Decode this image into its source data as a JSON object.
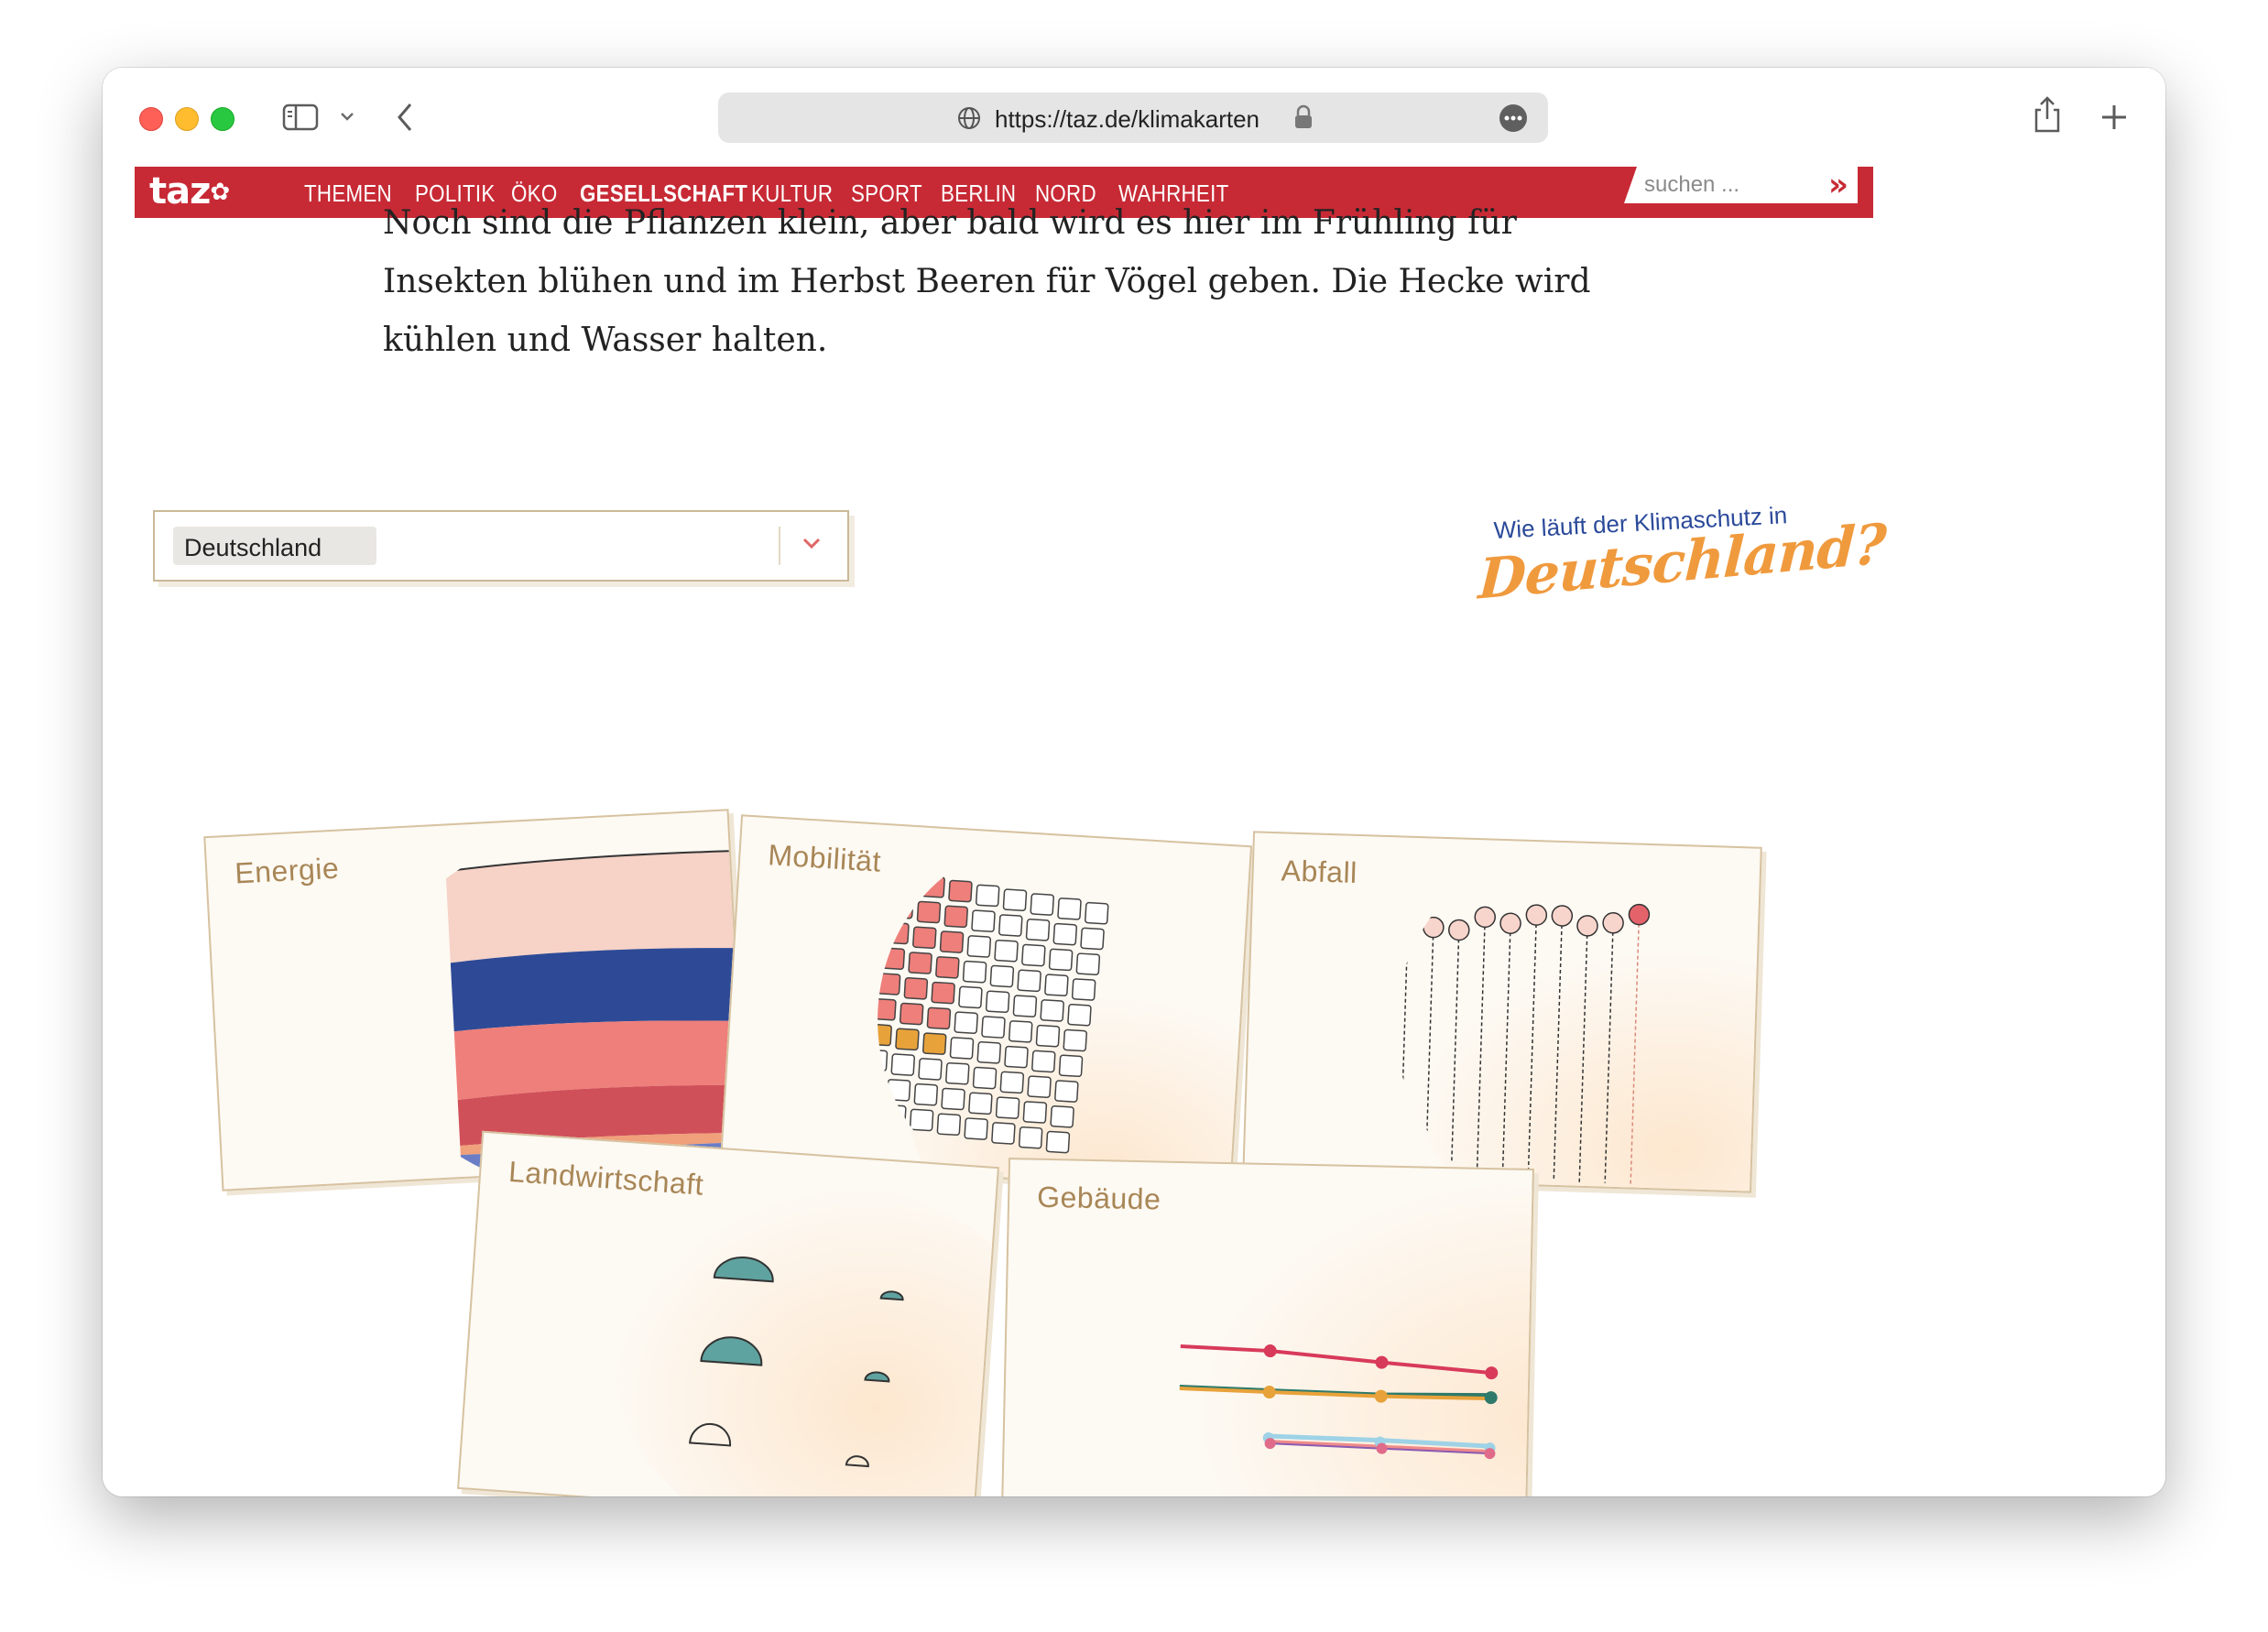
{
  "browser": {
    "url": "https://taz.de/klimakarten",
    "sidebar_icon": "sidebar-icon",
    "back_icon": "chevron-left-icon",
    "share_icon": "share-icon",
    "new_tab_icon": "plus-icon"
  },
  "site": {
    "logo": "taz",
    "nav": [
      "THEMEN",
      "POLITIK",
      "ÖKO",
      "GESELLSCHAFT",
      "KULTUR",
      "SPORT",
      "BERLIN",
      "NORD",
      "WAHRHEIT"
    ],
    "active_nav": "GESELLSCHAFT",
    "search_placeholder": "suchen ...",
    "search_button": "»",
    "brand_color": "#c72a35"
  },
  "article": {
    "lines": [
      "Noch sind die Pflanzen klein, aber bald wird es hier im Frühling für",
      "Insekten blühen und im Herbst Beeren für Vögel geben. Die Hecke wird",
      "kühlen und Wasser halten."
    ]
  },
  "selector": {
    "selected": "Deutschland"
  },
  "headline": {
    "question": "Wie läuft der Klimaschutz in",
    "country": "Deutschland?"
  },
  "cards": [
    {
      "label": "Energie"
    },
    {
      "label": "Mobilität"
    },
    {
      "label": "Abfall"
    },
    {
      "label": "Landwirtschaft"
    },
    {
      "label": "Gebäude"
    }
  ]
}
